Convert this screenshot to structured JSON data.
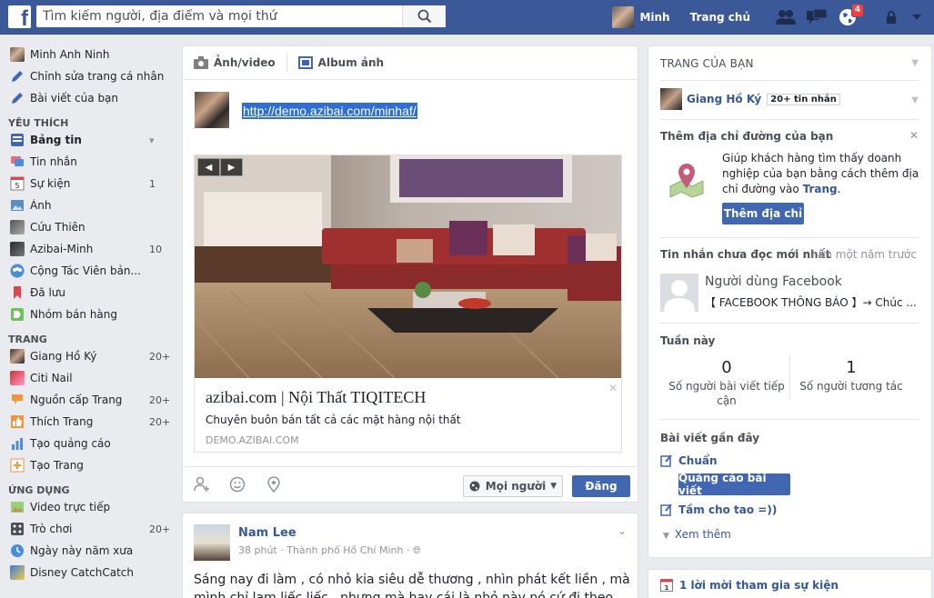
{
  "topbar": {
    "logo_letter": "f",
    "search_placeholder": "Tìm kiếm người, địa điểm và mọi thứ",
    "user_name": "Minh",
    "home_link": "Trang chủ",
    "notification_count": "4",
    "colors": {
      "brand": "#3b5998",
      "badge": "#fa3e3e"
    }
  },
  "leftnav": {
    "profile": [
      {
        "label": "Minh Anh Ninh",
        "icon": "avatar"
      },
      {
        "label": "Chỉnh sửa trang cá nhân",
        "icon": "pencil-icon"
      },
      {
        "label": "Bài viết của bạn",
        "icon": "post-icon"
      }
    ],
    "favorites_title": "YÊU THÍCH",
    "favorites": [
      {
        "label": "Bảng tin",
        "count": "",
        "icon": "newsfeed-icon"
      },
      {
        "label": "Tin nhắn",
        "count": "",
        "icon": "messages-icon"
      },
      {
        "label": "Sự kiện",
        "count": "1",
        "icon": "calendar-icon"
      },
      {
        "label": "Ảnh",
        "count": "",
        "icon": "photo-icon"
      },
      {
        "label": "Cứu Thiên",
        "count": "",
        "icon": "group-avatar"
      },
      {
        "label": "Azibai-Minh",
        "count": "10",
        "icon": "group-avatar"
      },
      {
        "label": "Cộng Tác Viên bản...",
        "count": "",
        "icon": "groups-icon"
      },
      {
        "label": "Đã lưu",
        "count": "",
        "icon": "bookmark-icon"
      },
      {
        "label": "Nhóm bán hàng",
        "count": "",
        "icon": "tag-icon"
      }
    ],
    "pages_title": "TRANG",
    "pages": [
      {
        "label": "Giang Hồ Ký",
        "count": "20+",
        "icon": "page-avatar"
      },
      {
        "label": "Citi Nail",
        "count": "",
        "icon": "page-avatar"
      },
      {
        "label": "Nguồn cấp Trang",
        "count": "20+",
        "icon": "page-feed-icon"
      },
      {
        "label": "Thích Trang",
        "count": "20+",
        "icon": "like-pages-icon"
      },
      {
        "label": "Tạo quảng cáo",
        "count": "",
        "icon": "ads-icon"
      },
      {
        "label": "Tạo Trang",
        "count": "",
        "icon": "create-page-icon"
      }
    ],
    "apps_title": "ỨNG DỤNG",
    "apps": [
      {
        "label": "Video trực tiếp",
        "count": "",
        "icon": "live-video-icon"
      },
      {
        "label": "Trò chơi",
        "count": "20+",
        "icon": "games-icon"
      },
      {
        "label": "Ngày này năm xưa",
        "count": "",
        "icon": "memories-icon"
      },
      {
        "label": "Disney CatchCatch",
        "count": "",
        "icon": "game-avatar"
      }
    ]
  },
  "composer": {
    "tab_photo": "Ảnh/video",
    "tab_album": "Album ảnh",
    "url_text": "http://demo.azibai.com/minhaf/",
    "preview": {
      "title": "azibai.com | Nội Thất TIQITECH",
      "description": "Chuyên buôn bán tất cả các mặt hàng nội thất",
      "domain": "DEMO.AZIBAI.COM"
    },
    "audience": "Mọi người",
    "post_button": "Đăng"
  },
  "post": {
    "author": "Nam Lee",
    "meta": "38 phút · Thành phố Hồ Chí Minh · ",
    "text": "Sáng nay đi làm , có nhỏ kia siêu dễ thương , nhìn phát kết liền , mà mình chỉ lạm liếc liếc , nhưng mà hay cái là nhỏ này nó cứ đi theo mình , mình"
  },
  "rightcol": {
    "pages_header": "TRANG CỦA BẠN",
    "page_name": "Giang Hồ Ký",
    "page_tag": "20+ tin nhắn",
    "address_title": "Thêm địa chỉ đường của bạn",
    "address_text_pre": "Giúp khách hàng tìm thấy doanh nghiệp của bạn bằng cách thêm địa chỉ đường vào ",
    "address_text_link": "Trang",
    "address_text_post": ".",
    "address_button": "Thêm địa chỉ",
    "unread_title": "Tin nhắn chưa đọc mới nhất",
    "unread_time": "hơn một năm trước",
    "msg_sender": "Người dùng Facebook",
    "msg_preview": "【 FACEBOOK THÔNG BÁO 】→ Chúc ...",
    "week_title": "Tuần này",
    "stat1_value": "0",
    "stat1_label": "Số người bài viết tiếp cận",
    "stat2_value": "1",
    "stat2_label": "Số người tương tác",
    "recent_title": "Bài viết gần đây",
    "recent1": "Chuẩn",
    "boost_button": "Quảng cáo bài viết",
    "recent2": "Tầm cho tao =))",
    "see_more": "Xem thêm",
    "event_invite": "1 lời mời tham gia sự kiện"
  }
}
